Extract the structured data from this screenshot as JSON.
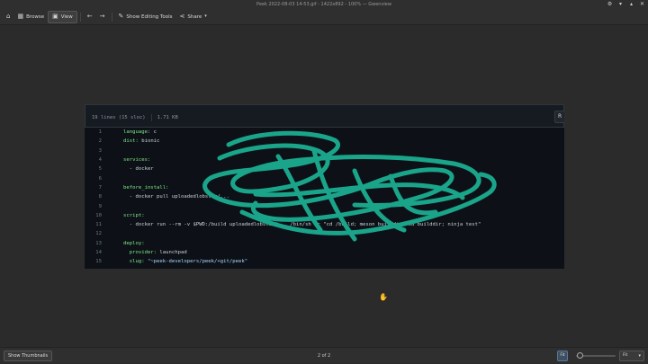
{
  "window": {
    "title": "Peek 2022-08-03 14-53.gif - 1422x892 - 100% — Gwenview"
  },
  "toolbar": {
    "browse_label": "Browse",
    "view_label": "View",
    "editing_label": "Show Editing Tools",
    "share_label": "Share"
  },
  "document": {
    "header_lines": "19 lines (15 sloc)",
    "header_size": "1.71 KB",
    "raw_label": "R",
    "lines": [
      {
        "n": "1",
        "key": "language:",
        "val": " c"
      },
      {
        "n": "2",
        "key": "dist:",
        "val": " bionic"
      },
      {
        "n": "3",
        "key": "",
        "val": ""
      },
      {
        "n": "4",
        "key": "services:",
        "val": ""
      },
      {
        "n": "5",
        "key": "",
        "val": "  - docker"
      },
      {
        "n": "6",
        "key": "",
        "val": ""
      },
      {
        "n": "7",
        "key": "before_install:",
        "val": ""
      },
      {
        "n": "8",
        "key": "",
        "val": "  - docker pull uploadedlobster/..."
      },
      {
        "n": "9",
        "key": "",
        "val": ""
      },
      {
        "n": "10",
        "key": "script:",
        "val": ""
      },
      {
        "n": "11",
        "key": "",
        "val": "  - docker run --rm -v $PWD:/build uploadedlobster/... /bin/sh -c \"cd /build; meson builddir; cd builddir; ninja test\""
      },
      {
        "n": "12",
        "key": "",
        "val": ""
      },
      {
        "n": "13",
        "key": "deploy:",
        "val": ""
      },
      {
        "n": "14",
        "key": "  provider:",
        "val": " launchpad"
      },
      {
        "n": "15",
        "key": "  slug:",
        "val": " \"~peek-developers/peek/+git/peek\""
      }
    ]
  },
  "status": {
    "thumbnails_label": "Show Thumbnails",
    "page_count": "2 of 2",
    "fit_label": "Fit",
    "zoom_value": "Fit",
    "zoom_level": 0.1
  },
  "colors": {
    "scribble": "#1aa58a"
  }
}
